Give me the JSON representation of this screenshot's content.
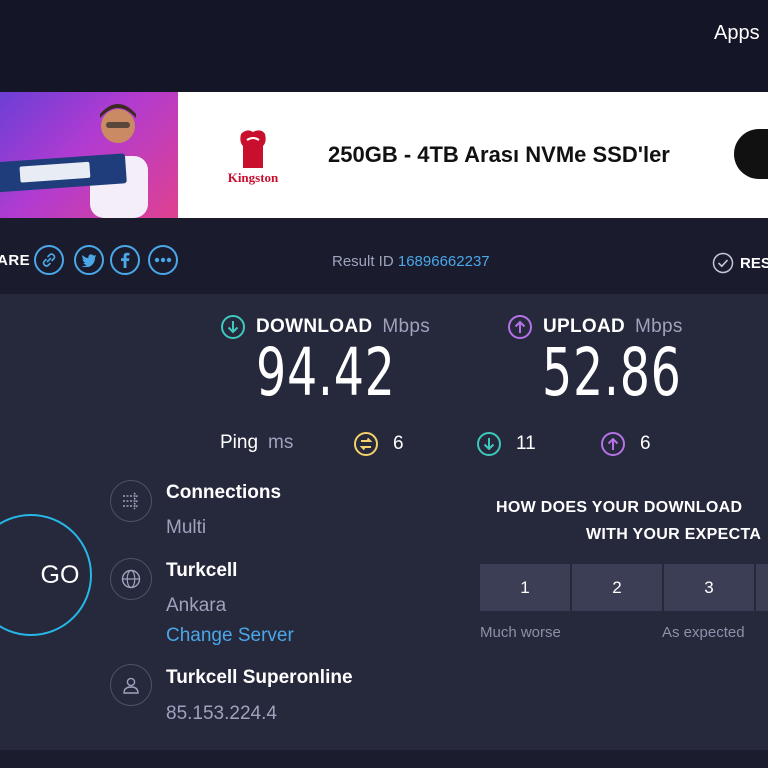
{
  "nav": {
    "apps_label": "Apps"
  },
  "ad": {
    "brand": "Kingston",
    "headline": "250GB - 4TB Arası NVMe SSD'ler"
  },
  "share": {
    "label": "ARE",
    "icons": [
      "link-icon",
      "twitter-icon",
      "facebook-icon",
      "more-icon"
    ],
    "result_id_label": "Result ID",
    "result_id": "16896662237",
    "results_label": "RES"
  },
  "download": {
    "label": "DOWNLOAD",
    "unit": "Mbps",
    "value": "94.42"
  },
  "upload": {
    "label": "UPLOAD",
    "unit": "Mbps",
    "value": "52.86"
  },
  "ping": {
    "label": "Ping",
    "unit": "ms",
    "idle": "6",
    "download": "11",
    "upload": "6"
  },
  "go_label": "GO",
  "connections": {
    "title": "Connections",
    "value": "Multi"
  },
  "server": {
    "title": "Turkcell",
    "location": "Ankara",
    "change_label": "Change Server"
  },
  "isp": {
    "title": "Turkcell Superonline",
    "ip": "85.153.224.4"
  },
  "survey": {
    "question_line1": "HOW DOES YOUR DOWNLOAD",
    "question_line2": "WITH YOUR EXPECTA",
    "options": [
      "1",
      "2",
      "3"
    ],
    "low_label": "Much worse",
    "mid_label": "As expected"
  },
  "colors": {
    "background": "#26283c",
    "accent_download": "#3ec9bd",
    "accent_upload": "#b673e8",
    "accent_ping": "#f3d16b",
    "link": "#4aa7e8"
  }
}
